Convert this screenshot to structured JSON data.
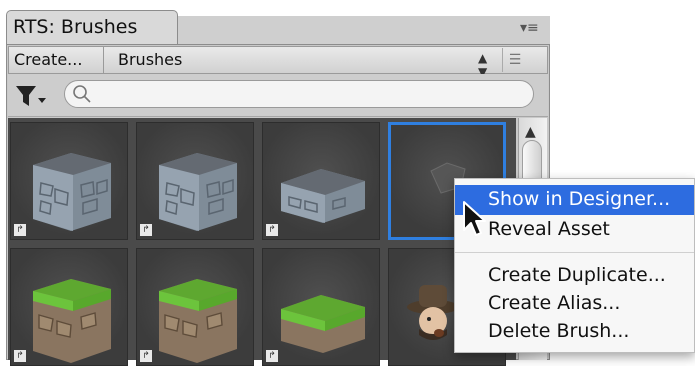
{
  "window": {
    "tab_title": "RTS: Brushes"
  },
  "toolbar": {
    "create_label": "Create...",
    "selected_category": "Brushes"
  },
  "search": {
    "placeholder": "",
    "value": ""
  },
  "colors": {
    "selection": "#2f7fe0",
    "menu_highlight": "#2d6ce0",
    "grass": "#6cc43c",
    "stone": "#8d98a4"
  },
  "context_menu": {
    "items": [
      {
        "label": "Show in Designer...",
        "highlighted": true
      },
      {
        "label": "Reveal Asset"
      },
      {
        "label": "Create Duplicate..."
      },
      {
        "label": "Create Alias..."
      },
      {
        "label": "Delete Brush..."
      }
    ]
  },
  "brushes": [
    {
      "kind": "stone-block",
      "alias": true
    },
    {
      "kind": "stone-block",
      "alias": true
    },
    {
      "kind": "stone-slab",
      "alias": true
    },
    {
      "kind": "empty-brush",
      "selected": true
    },
    {
      "kind": "grass-block",
      "alias": true
    },
    {
      "kind": "grass-block",
      "alias": true
    },
    {
      "kind": "grass-slab",
      "alias": true
    },
    {
      "kind": "character-figure"
    }
  ],
  "icons": {
    "alias_badge": "alias-icon",
    "filter": "filter-icon",
    "search": "search-icon",
    "panel_menu": "menu-icon",
    "scroll_up": "arrow-up-icon",
    "cursor": "mouse-cursor-icon"
  }
}
